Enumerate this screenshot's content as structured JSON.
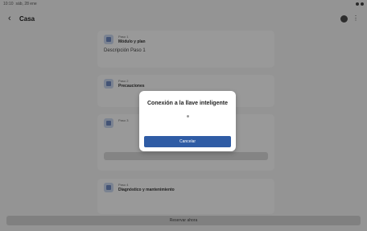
{
  "status_bar": {
    "time": "10:10",
    "date": "sáb, 28 ene"
  },
  "app_bar": {
    "title": "Casa",
    "back_icon": "back-arrow-icon",
    "help_icon": "help-icon",
    "more_icon": "more-vertical-icon"
  },
  "steps": [
    {
      "number": "Paso 1",
      "name": "Módulo y plan",
      "description": "Descripción Paso 1"
    },
    {
      "number": "Paso 2",
      "name": "Precauciones",
      "description": ""
    },
    {
      "number": "Paso 3",
      "name": "",
      "description": ""
    },
    {
      "number": "Paso 4",
      "name": "Diagnóstico y mantenimiento",
      "description": ""
    }
  ],
  "bottom_bar": {
    "label": "Reservar ahora"
  },
  "dialog": {
    "title": "Conexión a la llave inteligente",
    "cancel_label": "Cancelar"
  },
  "colors": {
    "primary": "#2f5ca5",
    "scrim": "rgba(0,0,0,0.38)"
  }
}
